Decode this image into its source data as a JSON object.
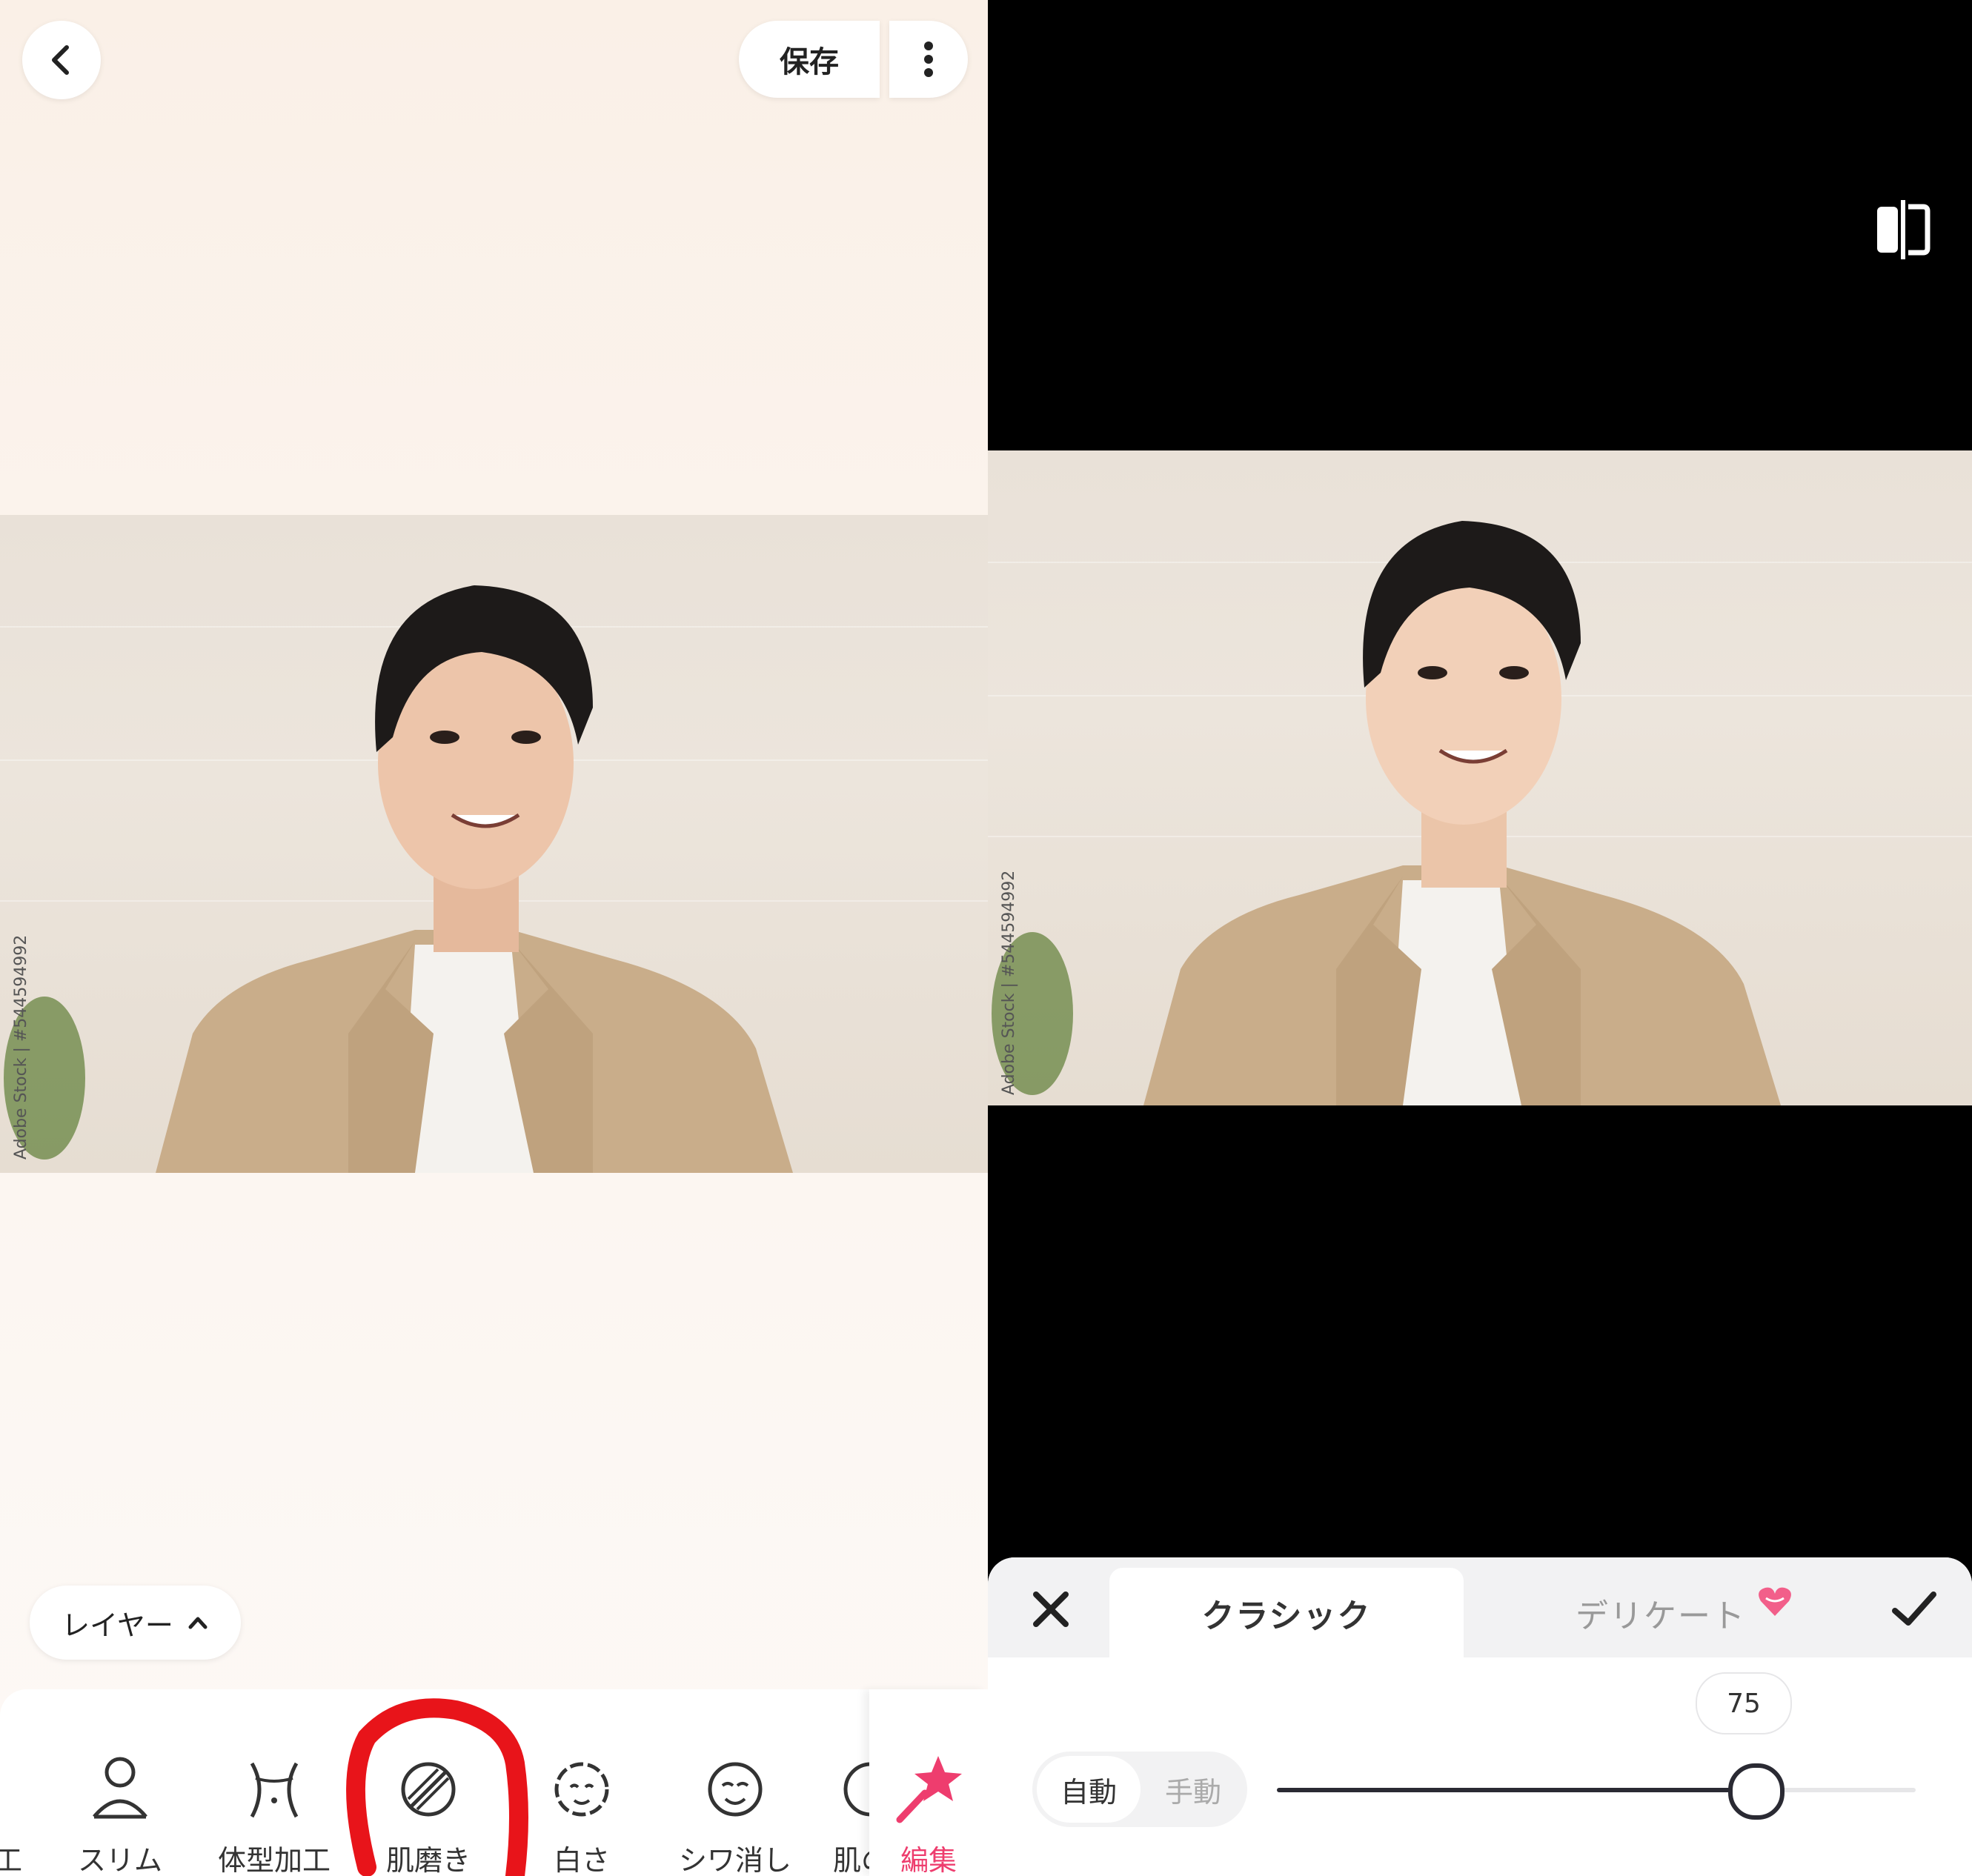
{
  "left": {
    "header": {
      "save_label": "保存"
    },
    "layer_label": "レイヤー",
    "photo_watermark": "Adobe Stock | #544594992",
    "tools": [
      {
        "label": "工",
        "icon": "partial-icon"
      },
      {
        "label": "スリム",
        "icon": "slim-person-icon"
      },
      {
        "label": "体型加工",
        "icon": "body-shape-icon"
      },
      {
        "label": "肌磨き",
        "icon": "skin-smooth-icon"
      },
      {
        "label": "白さ",
        "icon": "whitening-face-icon"
      },
      {
        "label": "シワ消し",
        "icon": "wrinkle-remove-icon"
      },
      {
        "label": "肌の",
        "icon": "skin-tone-icon"
      },
      {
        "label": "編集",
        "icon": "magic-wand-icon"
      }
    ],
    "accent_color": "#ee3d6e",
    "highlight_color": "#e8141a"
  },
  "right": {
    "photo_watermark": "Adobe Stock | #544594992",
    "panel": {
      "tabs": [
        "クラシック",
        "デリケート"
      ],
      "active_tab": "クラシック",
      "mode_options": [
        "自動",
        "手動"
      ],
      "active_mode": "自動",
      "slider_value": 75,
      "slider_display": "75",
      "slider_max": 100
    }
  }
}
